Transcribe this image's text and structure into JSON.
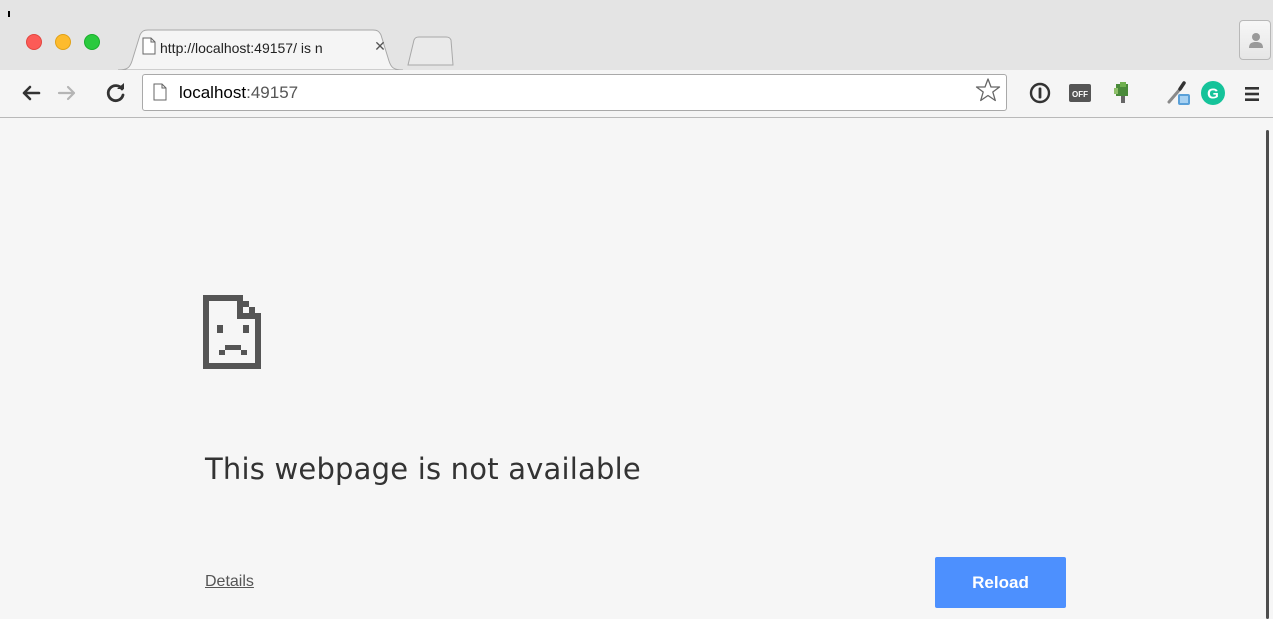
{
  "browser": {
    "tab": {
      "title": "http://localhost:49157/ is n",
      "close_icon": "close-icon",
      "page_icon": "document-icon"
    },
    "traffic_lights": {
      "close": "#fc5b57",
      "minimize": "#fdbb2d",
      "maximize": "#2aca3e"
    },
    "toolbar": {
      "back_icon": "arrow-back-icon",
      "forward_icon": "arrow-forward-icon",
      "reload_icon": "reload-icon",
      "omnibox": {
        "host": "localhost",
        "port": ":49157"
      },
      "bookmark_icon": "star-icon",
      "extensions": {
        "ext_badge_text": "OFF",
        "ext_g_letter": "G"
      },
      "menu_icon": "hamburger-menu-icon"
    }
  },
  "error_page": {
    "icon": "sad-page-icon",
    "title": "This webpage is not available",
    "details_label": "Details",
    "reload_label": "Reload"
  },
  "colors": {
    "reload_button": "#4d90fe",
    "page_background": "#f6f6f6",
    "grammarly_green": "#15c39a"
  }
}
